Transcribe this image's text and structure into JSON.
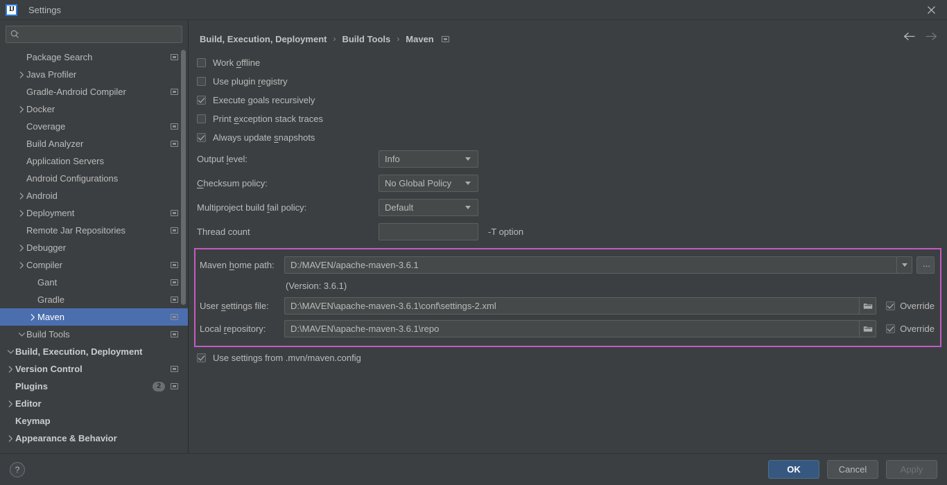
{
  "window": {
    "title": "Settings",
    "logo_text": "IJ",
    "close_label": "×"
  },
  "sidebar": {
    "search": {
      "value": "",
      "placeholder": ""
    },
    "items": [
      {
        "label": "Appearance & Behavior",
        "indent": 0,
        "arrow": "closed",
        "bold": true,
        "cfg": false,
        "selected": false
      },
      {
        "label": "Keymap",
        "indent": 0,
        "arrow": "none",
        "bold": true,
        "cfg": false,
        "selected": false
      },
      {
        "label": "Editor",
        "indent": 0,
        "arrow": "closed",
        "bold": true,
        "cfg": false,
        "selected": false
      },
      {
        "label": "Plugins",
        "indent": 0,
        "arrow": "none",
        "bold": true,
        "cfg": true,
        "selected": false,
        "badge": "2"
      },
      {
        "label": "Version Control",
        "indent": 0,
        "arrow": "closed",
        "bold": true,
        "cfg": true,
        "selected": false
      },
      {
        "label": "Build, Execution, Deployment",
        "indent": 0,
        "arrow": "open",
        "bold": true,
        "cfg": false,
        "selected": false
      },
      {
        "label": "Build Tools",
        "indent": 1,
        "arrow": "open",
        "bold": false,
        "cfg": true,
        "selected": false
      },
      {
        "label": "Maven",
        "indent": 2,
        "arrow": "closed",
        "bold": false,
        "cfg": true,
        "selected": true
      },
      {
        "label": "Gradle",
        "indent": 2,
        "arrow": "none",
        "bold": false,
        "cfg": true,
        "selected": false
      },
      {
        "label": "Gant",
        "indent": 2,
        "arrow": "none",
        "bold": false,
        "cfg": true,
        "selected": false
      },
      {
        "label": "Compiler",
        "indent": 1,
        "arrow": "closed",
        "bold": false,
        "cfg": true,
        "selected": false
      },
      {
        "label": "Debugger",
        "indent": 1,
        "arrow": "closed",
        "bold": false,
        "cfg": false,
        "selected": false
      },
      {
        "label": "Remote Jar Repositories",
        "indent": 1,
        "arrow": "none",
        "bold": false,
        "cfg": true,
        "selected": false
      },
      {
        "label": "Deployment",
        "indent": 1,
        "arrow": "closed",
        "bold": false,
        "cfg": true,
        "selected": false
      },
      {
        "label": "Android",
        "indent": 1,
        "arrow": "closed",
        "bold": false,
        "cfg": false,
        "selected": false
      },
      {
        "label": "Android Configurations",
        "indent": 1,
        "arrow": "none",
        "bold": false,
        "cfg": false,
        "selected": false
      },
      {
        "label": "Application Servers",
        "indent": 1,
        "arrow": "none",
        "bold": false,
        "cfg": false,
        "selected": false
      },
      {
        "label": "Build Analyzer",
        "indent": 1,
        "arrow": "none",
        "bold": false,
        "cfg": true,
        "selected": false
      },
      {
        "label": "Coverage",
        "indent": 1,
        "arrow": "none",
        "bold": false,
        "cfg": true,
        "selected": false
      },
      {
        "label": "Docker",
        "indent": 1,
        "arrow": "closed",
        "bold": false,
        "cfg": false,
        "selected": false
      },
      {
        "label": "Gradle-Android Compiler",
        "indent": 1,
        "arrow": "none",
        "bold": false,
        "cfg": true,
        "selected": false
      },
      {
        "label": "Java Profiler",
        "indent": 1,
        "arrow": "closed",
        "bold": false,
        "cfg": false,
        "selected": false
      },
      {
        "label": "Package Search",
        "indent": 1,
        "arrow": "none",
        "bold": false,
        "cfg": true,
        "selected": false
      }
    ]
  },
  "header": {
    "breadcrumbs": [
      "Build, Execution, Deployment",
      "Build Tools",
      "Maven"
    ],
    "separator": "›"
  },
  "main": {
    "checkboxes": [
      {
        "label_pre": "Work ",
        "mnemonic": "o",
        "label_post": "ffline",
        "checked": false
      },
      {
        "label_pre": "Use plugin ",
        "mnemonic": "r",
        "label_post": "egistry",
        "checked": false
      },
      {
        "label_pre": "Execute ",
        "mnemonic": "g",
        "label_post": "oals recursively",
        "checked": true
      },
      {
        "label_pre": "Print ",
        "mnemonic": "e",
        "label_post": "xception stack traces",
        "checked": false
      },
      {
        "label_pre": "Always update ",
        "mnemonic": "s",
        "label_post": "napshots",
        "checked": true
      }
    ],
    "combos": [
      {
        "label_pre": "Output ",
        "mnemonic": "l",
        "label_post": "evel:",
        "value": "Info"
      },
      {
        "label_pre": "",
        "mnemonic": "C",
        "label_post": "hecksum policy:",
        "value": "No Global Policy"
      },
      {
        "label_pre": "Multiproject build ",
        "mnemonic": "f",
        "label_post": "ail policy:",
        "value": "Default"
      }
    ],
    "thread_count": {
      "label": "Thread count",
      "value": "",
      "hint": "-T option"
    },
    "maven_block": {
      "home_path": {
        "label_pre": "Maven ",
        "mnemonic": "h",
        "label_post": "ome path:",
        "value": "D:/MAVEN/apache-maven-3.6.1",
        "browse_label": "..."
      },
      "version_text": "(Version: 3.6.1)",
      "user_settings": {
        "label_pre": "User ",
        "mnemonic": "s",
        "label_post": "ettings file:",
        "value": "D:\\MAVEN\\apache-maven-3.6.1\\conf\\settings-2.xml",
        "override_label": "Override",
        "override_checked": true
      },
      "local_repository": {
        "label_pre": "Local ",
        "mnemonic": "r",
        "label_post": "epository:",
        "value": "D:\\MAVEN\\apache-maven-3.6.1\\repo",
        "override_label": "Override",
        "override_checked": true
      },
      "highlight_color": "#c45ac4"
    },
    "mvn_config": {
      "label": "Use settings from .mvn/maven.config",
      "checked": true
    }
  },
  "footer": {
    "help_label": "?",
    "ok_label": "OK",
    "cancel_label": "Cancel",
    "apply_label": "Apply"
  }
}
